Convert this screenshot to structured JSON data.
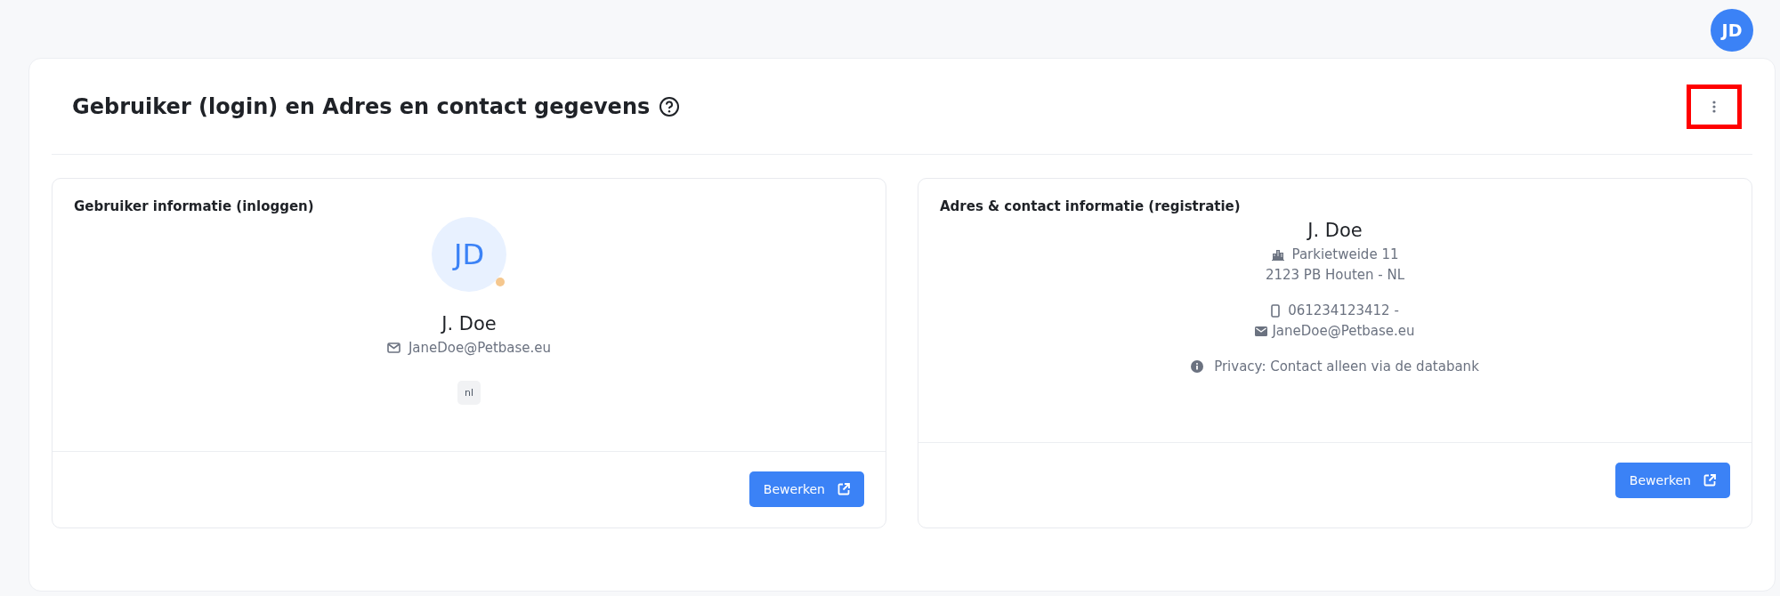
{
  "user_avatar": {
    "initials": "JD"
  },
  "section": {
    "title": "Gebruiker (login) en Adres en contact gegevens",
    "menu_highlighted": true
  },
  "user_card": {
    "title": "Gebruiker informatie (inloggen)",
    "avatar_initials": "JD",
    "status_indicator": true,
    "name": "J. Doe",
    "email": "JaneDoe@Petbase.eu",
    "language": "nl",
    "button": "Bewerken"
  },
  "contact_card": {
    "title": "Adres & contact informatie (registratie)",
    "name": "J. Doe",
    "street": "Parkietweide 11",
    "city": "2123 PB Houten - NL",
    "phone": "061234123412 -",
    "email": "JaneDoe@Petbase.eu",
    "privacy": "Privacy: Contact alleen via de databank",
    "button": "Bewerken"
  }
}
